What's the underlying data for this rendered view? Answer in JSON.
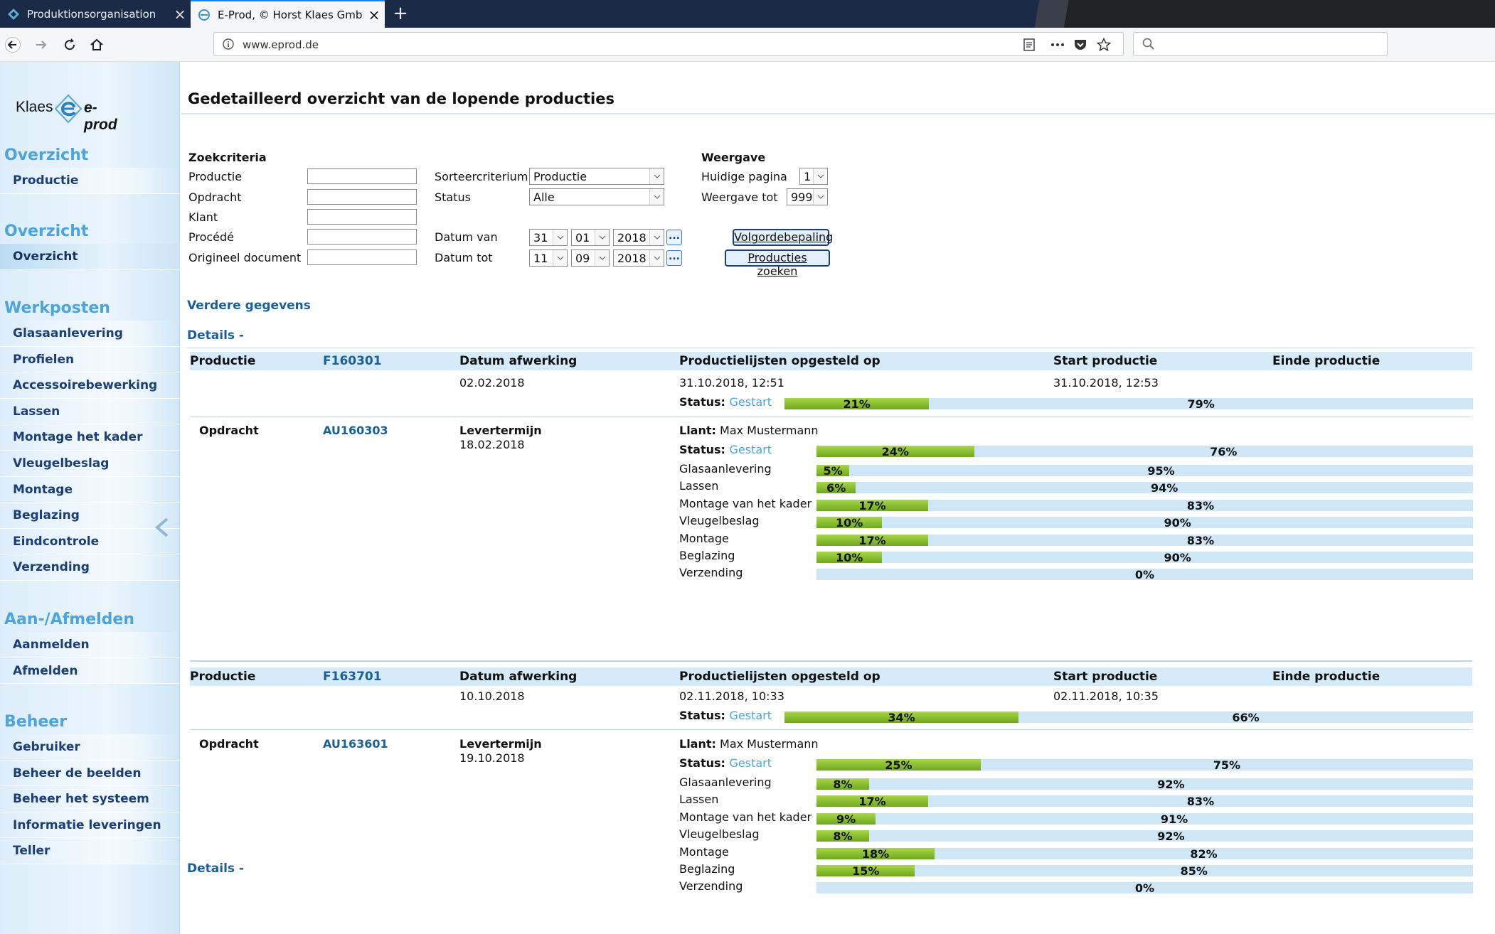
{
  "browser": {
    "tabs": [
      {
        "title": "Produktionsorganisation",
        "active": false
      },
      {
        "title": "E-Prod, © Horst Klaes GmbH &",
        "active": true
      }
    ],
    "url": "www.eprod.de"
  },
  "sidebar": {
    "logo": {
      "left": "Klaes",
      "right": "e-prod"
    },
    "groups": [
      {
        "title": "Overzicht",
        "items": [
          "Productie"
        ]
      },
      {
        "title": "Overzicht",
        "items": [
          "Overzicht"
        ]
      },
      {
        "title": "Werkposten",
        "items": [
          "Glasaanlevering",
          "Profielen",
          "Accessoirebewerking",
          "Lassen",
          "Montage het kader",
          "Vleugelbeslag",
          "Montage",
          "Beglazing",
          "Eindcontrole",
          "Verzending"
        ]
      },
      {
        "title": "Aan-/Afmelden",
        "items": [
          "Aanmelden",
          "Afmelden"
        ]
      },
      {
        "title": "Beheer",
        "items": [
          "Gebruiker",
          "Beheer de beelden",
          "Beheer het systeem",
          "Informatie leveringen",
          "Teller"
        ]
      }
    ]
  },
  "page": {
    "title": "Gedetailleerd overzicht van de lopende producties",
    "search": {
      "heading": "Zoekcriteria",
      "fields": [
        "Productie",
        "Opdracht",
        "Klant",
        "Procédé",
        "Origineel document"
      ],
      "sort_label": "Sorteercriterium",
      "sort_value": "Productie",
      "status_label": "Status",
      "status_value": "Alle",
      "date_from_label": "Datum van",
      "date_from": {
        "day": "31",
        "month": "01",
        "year": "2018"
      },
      "date_to_label": "Datum tot",
      "date_to": {
        "day": "11",
        "month": "09",
        "year": "2018"
      },
      "dots": "..."
    },
    "view": {
      "heading": "Weergave",
      "page_label": "Huidige pagina",
      "page_value": "1",
      "upto_label": "Weergave tot",
      "upto_value": "999"
    },
    "buttons": {
      "order": "Volgordebepaling",
      "search": "Producties zoeken"
    },
    "more_data": "Verdere gegevens",
    "details_link": "Details -",
    "columns": {
      "productie": "Productie",
      "datum_afwerking": "Datum afwerking",
      "lijsten": "Productielijsten opgesteld op",
      "start": "Start productie",
      "einde": "Einde productie",
      "opdracht": "Opdracht",
      "levertermijn": "Levertermijn",
      "klant_label": "Llant:",
      "status_label": "Status:"
    }
  },
  "productions": [
    {
      "id": "F160301",
      "datum_afwerking": "02.02.2018",
      "lijsten": "31.10.2018, 12:51",
      "start": "31.10.2018, 12:53",
      "status": "Gestart",
      "progress": 21,
      "progress_done_label": "21%",
      "progress_rest_label": "79%",
      "order": {
        "id": "AU160303",
        "levertermijn": "18.02.2018",
        "klant": "Max Mustermann",
        "status": "Gestart",
        "progress": 24,
        "done_label": "24%",
        "rest_label": "76%",
        "stations": [
          {
            "name": "Glasaanlevering",
            "progress": 5,
            "done": "5%",
            "rest": "95%"
          },
          {
            "name": "Lassen",
            "progress": 6,
            "done": "6%",
            "rest": "94%"
          },
          {
            "name": "Montage van het kader",
            "progress": 17,
            "done": "17%",
            "rest": "83%"
          },
          {
            "name": "Vleugelbeslag",
            "progress": 10,
            "done": "10%",
            "rest": "90%"
          },
          {
            "name": "Montage",
            "progress": 17,
            "done": "17%",
            "rest": "83%"
          },
          {
            "name": "Beglazing",
            "progress": 10,
            "done": "10%",
            "rest": "90%"
          },
          {
            "name": "Verzending",
            "progress": 0,
            "done": "",
            "rest": "0%"
          }
        ]
      }
    },
    {
      "id": "F163701",
      "datum_afwerking": "10.10.2018",
      "lijsten": "02.11.2018, 10:33",
      "start": "02.11.2018, 10:35",
      "status": "Gestart",
      "progress": 34,
      "progress_done_label": "34%",
      "progress_rest_label": "66%",
      "order": {
        "id": "AU163601",
        "levertermijn": "19.10.2018",
        "klant": "Max Mustermann",
        "status": "Gestart",
        "progress": 25,
        "done_label": "25%",
        "rest_label": "75%",
        "stations": [
          {
            "name": "Glasaanlevering",
            "progress": 8,
            "done": "8%",
            "rest": "92%"
          },
          {
            "name": "Lassen",
            "progress": 17,
            "done": "17%",
            "rest": "83%"
          },
          {
            "name": "Montage van het kader",
            "progress": 9,
            "done": "9%",
            "rest": "91%"
          },
          {
            "name": "Vleugelbeslag",
            "progress": 8,
            "done": "8%",
            "rest": "92%"
          },
          {
            "name": "Montage",
            "progress": 18,
            "done": "18%",
            "rest": "82%"
          },
          {
            "name": "Beglazing",
            "progress": 15,
            "done": "15%",
            "rest": "85%"
          },
          {
            "name": "Verzending",
            "progress": 0,
            "done": "",
            "rest": "0%"
          }
        ]
      }
    }
  ]
}
